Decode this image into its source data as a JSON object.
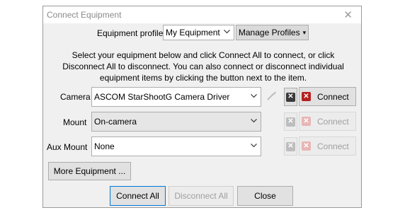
{
  "window": {
    "title": "Connect Equipment",
    "close_glyph": "✕"
  },
  "profile": {
    "label": "Equipment profile",
    "value": "My Equipment",
    "manage_label": "Manage Profiles",
    "manage_arrow": "▾"
  },
  "instructions": "Select your equipment below and click Connect All to connect, or click Disconnect All to disconnect. You can also connect or disconnect individual equipment items by clicking the button next to the item.",
  "rows": [
    {
      "label": "Camera",
      "value": "ASCOM StarShootG Camera Driver",
      "connect_label": "Connect",
      "enabled": true
    },
    {
      "label": "Mount",
      "value": "On-camera",
      "connect_label": "Connect",
      "enabled": false
    },
    {
      "label": "Aux Mount",
      "value": "None",
      "connect_label": "Connect",
      "enabled": false
    }
  ],
  "icons": {
    "settings": "settings-wrench-icon",
    "disconnect": "disconnect-x-icon",
    "connect": "connect-x-icon",
    "chevron": "chevron-down-icon",
    "close": "close-icon"
  },
  "colors": {
    "disconnect_icon": "#3a3a3a",
    "connect_icon": "#b5201e",
    "disabled_icon": "#bdbdbd",
    "dialog_bg": "#f0f0f0",
    "primary_border": "#0078d7"
  },
  "buttons": {
    "more_equipment": "More Equipment ...",
    "connect_all": "Connect All",
    "disconnect_all": "Disconnect All",
    "close": "Close"
  }
}
